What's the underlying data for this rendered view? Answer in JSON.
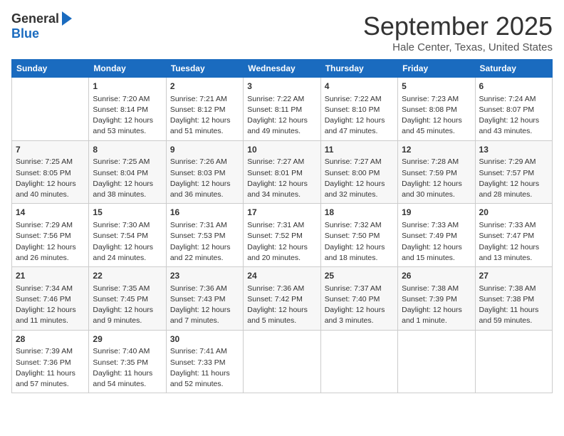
{
  "logo": {
    "general": "General",
    "blue": "Blue"
  },
  "title": "September 2025",
  "subtitle": "Hale Center, Texas, United States",
  "days_of_week": [
    "Sunday",
    "Monday",
    "Tuesday",
    "Wednesday",
    "Thursday",
    "Friday",
    "Saturday"
  ],
  "weeks": [
    [
      {
        "day": "",
        "info": ""
      },
      {
        "day": "1",
        "info": "Sunrise: 7:20 AM\nSunset: 8:14 PM\nDaylight: 12 hours\nand 53 minutes."
      },
      {
        "day": "2",
        "info": "Sunrise: 7:21 AM\nSunset: 8:12 PM\nDaylight: 12 hours\nand 51 minutes."
      },
      {
        "day": "3",
        "info": "Sunrise: 7:22 AM\nSunset: 8:11 PM\nDaylight: 12 hours\nand 49 minutes."
      },
      {
        "day": "4",
        "info": "Sunrise: 7:22 AM\nSunset: 8:10 PM\nDaylight: 12 hours\nand 47 minutes."
      },
      {
        "day": "5",
        "info": "Sunrise: 7:23 AM\nSunset: 8:08 PM\nDaylight: 12 hours\nand 45 minutes."
      },
      {
        "day": "6",
        "info": "Sunrise: 7:24 AM\nSunset: 8:07 PM\nDaylight: 12 hours\nand 43 minutes."
      }
    ],
    [
      {
        "day": "7",
        "info": "Sunrise: 7:25 AM\nSunset: 8:05 PM\nDaylight: 12 hours\nand 40 minutes."
      },
      {
        "day": "8",
        "info": "Sunrise: 7:25 AM\nSunset: 8:04 PM\nDaylight: 12 hours\nand 38 minutes."
      },
      {
        "day": "9",
        "info": "Sunrise: 7:26 AM\nSunset: 8:03 PM\nDaylight: 12 hours\nand 36 minutes."
      },
      {
        "day": "10",
        "info": "Sunrise: 7:27 AM\nSunset: 8:01 PM\nDaylight: 12 hours\nand 34 minutes."
      },
      {
        "day": "11",
        "info": "Sunrise: 7:27 AM\nSunset: 8:00 PM\nDaylight: 12 hours\nand 32 minutes."
      },
      {
        "day": "12",
        "info": "Sunrise: 7:28 AM\nSunset: 7:59 PM\nDaylight: 12 hours\nand 30 minutes."
      },
      {
        "day": "13",
        "info": "Sunrise: 7:29 AM\nSunset: 7:57 PM\nDaylight: 12 hours\nand 28 minutes."
      }
    ],
    [
      {
        "day": "14",
        "info": "Sunrise: 7:29 AM\nSunset: 7:56 PM\nDaylight: 12 hours\nand 26 minutes."
      },
      {
        "day": "15",
        "info": "Sunrise: 7:30 AM\nSunset: 7:54 PM\nDaylight: 12 hours\nand 24 minutes."
      },
      {
        "day": "16",
        "info": "Sunrise: 7:31 AM\nSunset: 7:53 PM\nDaylight: 12 hours\nand 22 minutes."
      },
      {
        "day": "17",
        "info": "Sunrise: 7:31 AM\nSunset: 7:52 PM\nDaylight: 12 hours\nand 20 minutes."
      },
      {
        "day": "18",
        "info": "Sunrise: 7:32 AM\nSunset: 7:50 PM\nDaylight: 12 hours\nand 18 minutes."
      },
      {
        "day": "19",
        "info": "Sunrise: 7:33 AM\nSunset: 7:49 PM\nDaylight: 12 hours\nand 15 minutes."
      },
      {
        "day": "20",
        "info": "Sunrise: 7:33 AM\nSunset: 7:47 PM\nDaylight: 12 hours\nand 13 minutes."
      }
    ],
    [
      {
        "day": "21",
        "info": "Sunrise: 7:34 AM\nSunset: 7:46 PM\nDaylight: 12 hours\nand 11 minutes."
      },
      {
        "day": "22",
        "info": "Sunrise: 7:35 AM\nSunset: 7:45 PM\nDaylight: 12 hours\nand 9 minutes."
      },
      {
        "day": "23",
        "info": "Sunrise: 7:36 AM\nSunset: 7:43 PM\nDaylight: 12 hours\nand 7 minutes."
      },
      {
        "day": "24",
        "info": "Sunrise: 7:36 AM\nSunset: 7:42 PM\nDaylight: 12 hours\nand 5 minutes."
      },
      {
        "day": "25",
        "info": "Sunrise: 7:37 AM\nSunset: 7:40 PM\nDaylight: 12 hours\nand 3 minutes."
      },
      {
        "day": "26",
        "info": "Sunrise: 7:38 AM\nSunset: 7:39 PM\nDaylight: 12 hours\nand 1 minute."
      },
      {
        "day": "27",
        "info": "Sunrise: 7:38 AM\nSunset: 7:38 PM\nDaylight: 11 hours\nand 59 minutes."
      }
    ],
    [
      {
        "day": "28",
        "info": "Sunrise: 7:39 AM\nSunset: 7:36 PM\nDaylight: 11 hours\nand 57 minutes."
      },
      {
        "day": "29",
        "info": "Sunrise: 7:40 AM\nSunset: 7:35 PM\nDaylight: 11 hours\nand 54 minutes."
      },
      {
        "day": "30",
        "info": "Sunrise: 7:41 AM\nSunset: 7:33 PM\nDaylight: 11 hours\nand 52 minutes."
      },
      {
        "day": "",
        "info": ""
      },
      {
        "day": "",
        "info": ""
      },
      {
        "day": "",
        "info": ""
      },
      {
        "day": "",
        "info": ""
      }
    ]
  ]
}
